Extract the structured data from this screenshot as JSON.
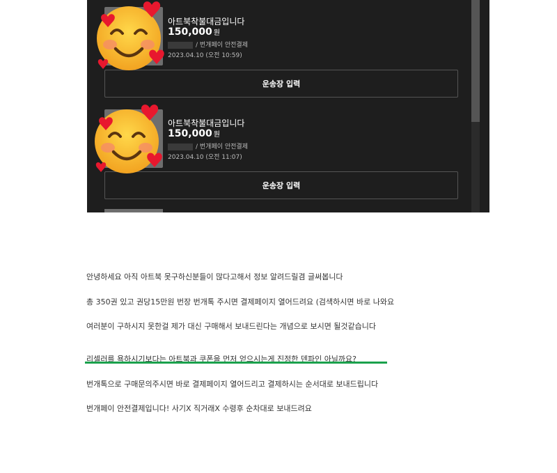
{
  "orders": [
    {
      "title": "아트북착불대금입니다",
      "price": "150,000",
      "currency": "원",
      "buyer_suffix": "/ 번개페이 안전결제",
      "date": "2023.04.10 (오전 10:59)",
      "button_label": "운송장 입력"
    },
    {
      "title": "아트북착불대금입니다",
      "price": "150,000",
      "currency": "원",
      "buyer_suffix": "/ 번개페이 안전결제",
      "date": "2023.04.10 (오전 11:07)",
      "button_label": "운송장 입력"
    }
  ],
  "post_lines": [
    "안녕하세요 아직 아트북 못구하신분들이 많다고해서 정보 알려드릴겸 글써봅니다",
    "총 350권 있고 권당15만원 번장 번개톡 주시면 결제페이지 열어드려요 (검색하시면 바로 나와요",
    "여러분이 구하시지 못한걸 제가 대신 구매해서 보내드린다는 개념으로 보시면 될것같습니다",
    "리셀러를 욕하시기보다는 아트북과 쿠폰을 먼저 얻으시는게 진정한 덴파인 아닐까요?",
    "번개톡으로 구매문의주시면 바로 결제페이지 열어드리고 결제하시는 순서대로 보내드립니다",
    "번개페이 안전결제입니다! 사기X 직거래X 수령후 순차대로 보내드려요"
  ],
  "icons": {
    "emoji": "smiling-face-with-hearts-icon"
  },
  "colors": {
    "panel_bg": "#1e1e1e",
    "underline": "#1aa14c"
  }
}
